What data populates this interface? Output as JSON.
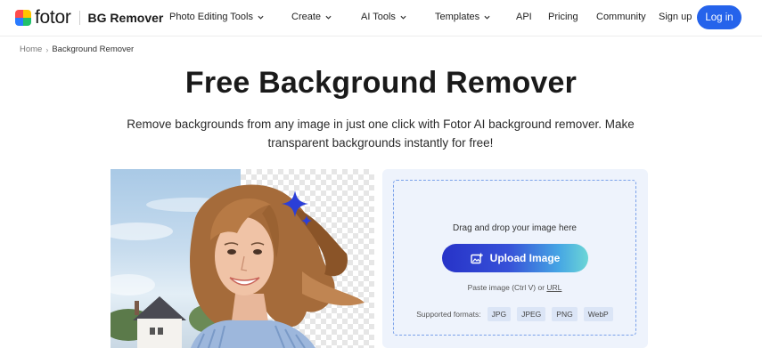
{
  "header": {
    "brand": "fotor",
    "product": "BG Remover",
    "nav": [
      {
        "label": "Photo Editing Tools",
        "has_dropdown": true
      },
      {
        "label": "Create",
        "has_dropdown": true
      },
      {
        "label": "AI Tools",
        "has_dropdown": true
      },
      {
        "label": "Templates",
        "has_dropdown": true
      },
      {
        "label": "API",
        "has_dropdown": false
      },
      {
        "label": "Pricing",
        "has_dropdown": false
      },
      {
        "label": "Community",
        "has_dropdown": false
      }
    ],
    "signup": "Sign up",
    "login": "Log in",
    "accent_color": "#2563eb"
  },
  "breadcrumb": {
    "home": "Home",
    "separator": "›",
    "current": "Background Remover"
  },
  "hero": {
    "title": "Free Background Remover",
    "subtitle": "Remove backgrounds from any image in just one click with Fotor AI background remover. Make transparent backgrounds instantly for free!"
  },
  "upload": {
    "drag_text": "Drag and drop your image here",
    "button_label": "Upload Image",
    "paste_prefix": "Paste image (Ctrl V) or ",
    "url_link": "URL",
    "formats_label": "Supported formats:",
    "formats": [
      "JPG",
      "JPEG",
      "PNG",
      "WebP"
    ]
  }
}
